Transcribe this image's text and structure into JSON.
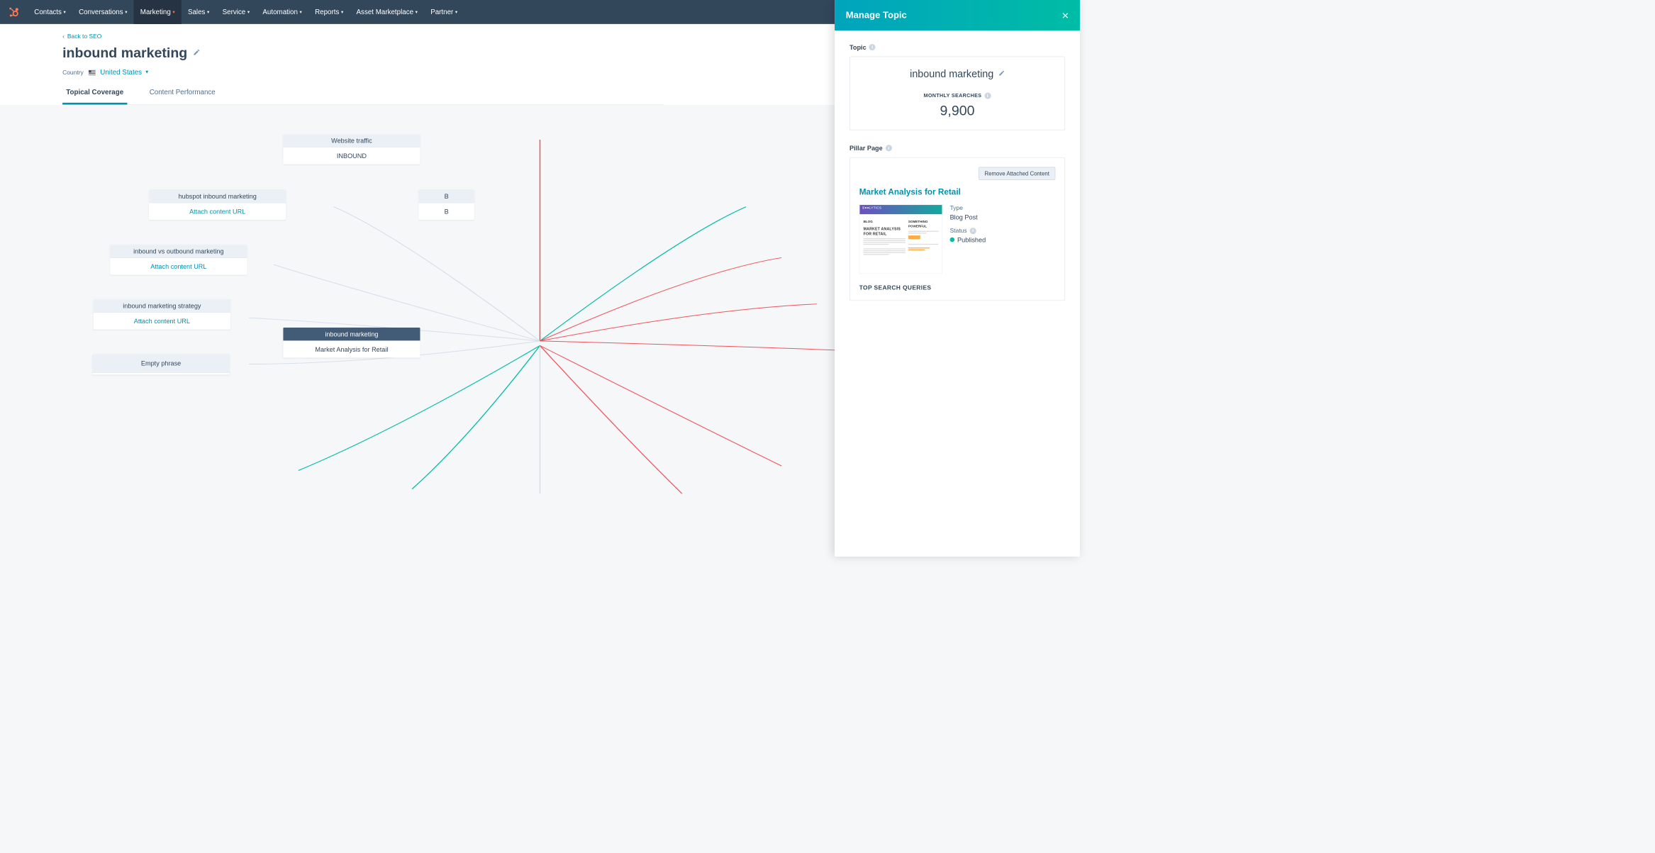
{
  "nav": {
    "items": [
      "Contacts",
      "Conversations",
      "Marketing",
      "Sales",
      "Service",
      "Automation",
      "Reports",
      "Asset Marketplace",
      "Partner"
    ],
    "active_index": 2
  },
  "back_link": "Back to SEO",
  "title": "inbound marketing",
  "country": {
    "label": "Country",
    "value": "United States"
  },
  "tabs": {
    "items": [
      "Topical Coverage",
      "Content Performance"
    ],
    "active_index": 0
  },
  "cluster": {
    "center": {
      "label": "inbound marketing",
      "subtitle": "Market Analysis for Retail"
    },
    "nodes": [
      {
        "label": "Website traffic",
        "body": "INBOUND",
        "attach": false
      },
      {
        "label": "hubspot inbound marketing",
        "body": "Attach content URL",
        "attach": true
      },
      {
        "label": "inbound vs outbound marketing",
        "body": "Attach content URL",
        "attach": true
      },
      {
        "label": "inbound marketing strategy",
        "body": "Attach content URL",
        "attach": true
      },
      {
        "label": "Empty phrase",
        "body": "",
        "attach": false
      },
      {
        "label": "B",
        "body": "B",
        "attach": false
      }
    ]
  },
  "panel": {
    "title": "Manage Topic",
    "topic_label": "Topic",
    "topic_name": "inbound marketing",
    "searches_label": "MONTHLY SEARCHES",
    "searches_value": "9,900",
    "pillar_label": "Pillar Page",
    "remove_btn": "Remove Attached Content",
    "pillar_title": "Market Analysis for Retail",
    "type_label": "Type",
    "type_value": "Blog Post",
    "status_label": "Status",
    "status_value": "Published",
    "queries_label": "TOP SEARCH QUERIES",
    "preview": {
      "blog": "BLOG",
      "headline": "MARKET ANALYSIS FOR RETAIL",
      "side": "SOMETHING POWERFUL"
    }
  }
}
